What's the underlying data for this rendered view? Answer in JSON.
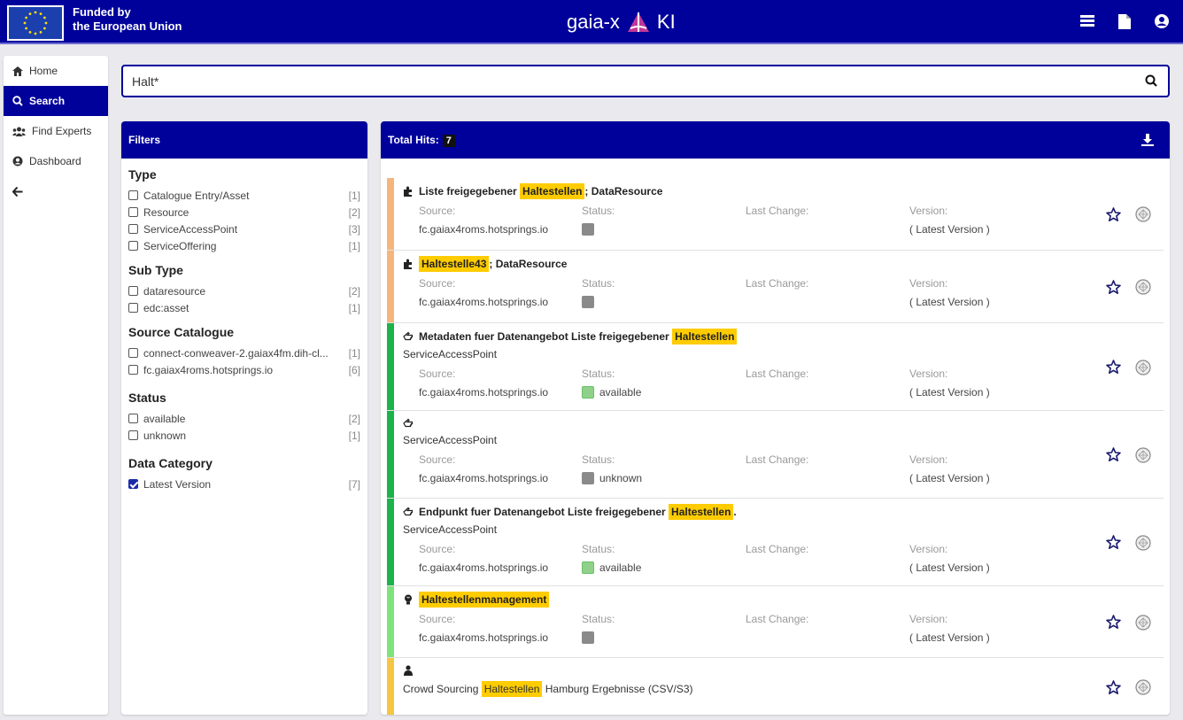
{
  "header": {
    "funded_line1": "Funded by",
    "funded_line2": "the European Union",
    "brand_left": "gaia-x",
    "brand_right": "KI"
  },
  "sidebar": {
    "items": [
      {
        "label": "Home",
        "icon": "home-icon"
      },
      {
        "label": "Search",
        "icon": "search-icon",
        "active": true
      },
      {
        "label": "Find Experts",
        "icon": "users-icon"
      },
      {
        "label": "Dashboard",
        "icon": "user-circle-icon"
      }
    ]
  },
  "search": {
    "value": "Halt*"
  },
  "filters": {
    "header": "Filters",
    "groups": [
      {
        "title": "Type",
        "options": [
          {
            "label": "Catalogue Entry/Asset",
            "count": "[1]",
            "checked": false
          },
          {
            "label": "Resource",
            "count": "[2]",
            "checked": false
          },
          {
            "label": "ServiceAccessPoint",
            "count": "[3]",
            "checked": false
          },
          {
            "label": "ServiceOffering",
            "count": "[1]",
            "checked": false
          }
        ]
      },
      {
        "title": "Sub Type",
        "options": [
          {
            "label": "dataresource",
            "count": "[2]",
            "checked": false
          },
          {
            "label": "edc:asset",
            "count": "[1]",
            "checked": false
          }
        ]
      },
      {
        "title": "Source Catalogue",
        "options": [
          {
            "label": "connect-conweaver-2.gaiax4fm.dih-cl...",
            "count": "[1]",
            "checked": false
          },
          {
            "label": "fc.gaiax4roms.hotsprings.io",
            "count": "[6]",
            "checked": false
          }
        ]
      },
      {
        "title": "Status",
        "options": [
          {
            "label": "available",
            "count": "[2]",
            "checked": false
          },
          {
            "label": "unknown",
            "count": "[1]",
            "checked": false
          }
        ]
      },
      {
        "title": "Data Category",
        "options": [
          {
            "label": "Latest Version",
            "count": "[7]",
            "checked": true
          }
        ]
      }
    ]
  },
  "results": {
    "total_label": "Total Hits:",
    "total": "7",
    "meta_labels": {
      "source": "Source:",
      "status": "Status:",
      "last_change": "Last Change:",
      "version": "Version:"
    },
    "items": [
      {
        "color": "#f5b67d",
        "icon": "puzzle-icon",
        "title_pre": "Liste freigegebener ",
        "title_hl": "Haltestellen",
        "title_post": "; DataResource",
        "subtitle": "",
        "source": "fc.gaiax4roms.hotsprings.io",
        "status": "",
        "status_color": "grey",
        "version": "( Latest Version )"
      },
      {
        "color": "#f5b67d",
        "icon": "puzzle-icon",
        "title_pre": "",
        "title_hl": "Haltestelle43",
        "title_post": "; DataResource",
        "subtitle": "",
        "source": "fc.gaiax4roms.hotsprings.io",
        "status": "",
        "status_color": "grey",
        "version": "( Latest Version )"
      },
      {
        "color": "#1cb34a",
        "icon": "hand-pointer-icon",
        "title_pre": "Metadaten fuer Datenangebot Liste freigegebener ",
        "title_hl": "Haltestellen",
        "title_post": "",
        "subtitle": "ServiceAccessPoint",
        "source": "fc.gaiax4roms.hotsprings.io",
        "status": "available",
        "status_color": "green",
        "version": "( Latest Version )"
      },
      {
        "color": "#1cb34a",
        "icon": "hand-pointer-icon",
        "title_pre": "",
        "title_hl": "",
        "title_post": "",
        "subtitle": "ServiceAccessPoint",
        "source": "fc.gaiax4roms.hotsprings.io",
        "status": "unknown",
        "status_color": "grey",
        "version": "( Latest Version )"
      },
      {
        "color": "#1cb34a",
        "icon": "hand-pointer-icon",
        "title_pre": "Endpunkt fuer Datenangebot Liste freigegebener ",
        "title_hl": "Haltestellen",
        "title_post": ".",
        "subtitle": "ServiceAccessPoint",
        "source": "fc.gaiax4roms.hotsprings.io",
        "status": "available",
        "status_color": "green",
        "version": "( Latest Version )"
      },
      {
        "color": "#7ee37a",
        "icon": "lightbulb-icon",
        "title_pre": "",
        "title_hl": "Haltestellenmanagement",
        "title_post": "",
        "subtitle": "",
        "source": "fc.gaiax4roms.hotsprings.io",
        "status": "",
        "status_color": "grey",
        "version": "( Latest Version )"
      },
      {
        "color": "#f6c544",
        "icon": "user-icon",
        "title_pre": "",
        "title_hl": "",
        "title_post": "",
        "sub_pre": "Crowd Sourcing ",
        "sub_hl": "Haltestellen",
        "sub_post": " Hamburg Ergebnisse (CSV/S3)"
      }
    ]
  },
  "colors": {
    "primary": "#00009b",
    "highlight": "#ffcc00"
  }
}
